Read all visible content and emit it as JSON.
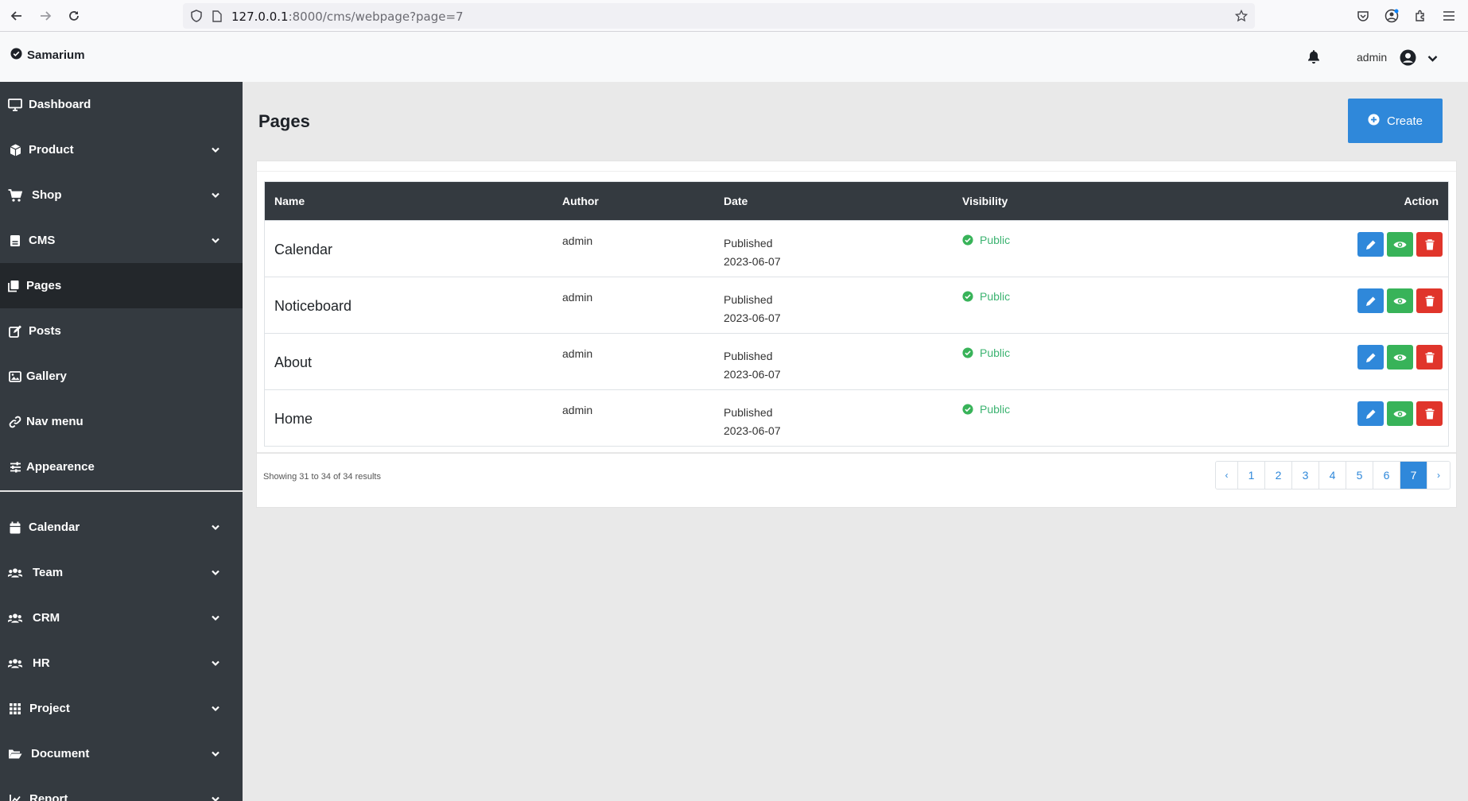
{
  "browser": {
    "url_host": "127.0.0.1",
    "url_rest": ":8000/cms/webpage?page=7"
  },
  "header": {
    "brand": "Samarium",
    "user": "admin"
  },
  "sidebar": {
    "items": [
      {
        "label": "Dashboard",
        "icon": "monitor-icon",
        "has_chevron": false,
        "active": false
      },
      {
        "label": "Product",
        "icon": "box-icon",
        "has_chevron": true,
        "active": false
      },
      {
        "label": "Shop",
        "icon": "cart-icon",
        "has_chevron": true,
        "active": false
      },
      {
        "label": "CMS",
        "icon": "cms-icon",
        "has_chevron": true,
        "active": false
      },
      {
        "label": "Pages",
        "icon": "pages-icon",
        "has_chevron": false,
        "active": true
      },
      {
        "label": "Posts",
        "icon": "edit-icon",
        "has_chevron": false,
        "active": false
      },
      {
        "label": "Gallery",
        "icon": "image-icon",
        "has_chevron": false,
        "active": false
      },
      {
        "label": "Nav menu",
        "icon": "link-icon",
        "has_chevron": false,
        "active": false
      },
      {
        "label": "Appearence",
        "icon": "sliders-icon",
        "has_chevron": false,
        "active": false
      },
      {
        "label": "Calendar",
        "icon": "calendar-icon",
        "has_chevron": true,
        "active": false
      },
      {
        "label": "Team",
        "icon": "users-icon",
        "has_chevron": true,
        "active": false
      },
      {
        "label": "CRM",
        "icon": "users-icon",
        "has_chevron": true,
        "active": false
      },
      {
        "label": "HR",
        "icon": "users-icon",
        "has_chevron": true,
        "active": false
      },
      {
        "label": "Project",
        "icon": "grid-icon",
        "has_chevron": true,
        "active": false
      },
      {
        "label": "Document",
        "icon": "folder-icon",
        "has_chevron": true,
        "active": false
      },
      {
        "label": "Report",
        "icon": "chart-icon",
        "has_chevron": true,
        "active": false
      }
    ]
  },
  "main": {
    "title": "Pages",
    "create_label": "Create",
    "table": {
      "headers": {
        "name": "Name",
        "author": "Author",
        "date": "Date",
        "visibility": "Visibility",
        "action": "Action"
      },
      "rows": [
        {
          "name": "Calendar",
          "author": "admin",
          "status": "Published",
          "date": "2023-06-07",
          "visibility": "Public"
        },
        {
          "name": "Noticeboard",
          "author": "admin",
          "status": "Published",
          "date": "2023-06-07",
          "visibility": "Public"
        },
        {
          "name": "About",
          "author": "admin",
          "status": "Published",
          "date": "2023-06-07",
          "visibility": "Public"
        },
        {
          "name": "Home",
          "author": "admin",
          "status": "Published",
          "date": "2023-06-07",
          "visibility": "Public"
        }
      ]
    },
    "results_text": "Showing 31 to 34 of 34 results",
    "pagination": {
      "prev": "‹",
      "next": "›",
      "pages": [
        "1",
        "2",
        "3",
        "4",
        "5",
        "6",
        "7"
      ],
      "current": "7"
    }
  },
  "colors": {
    "accent": "#2f88da",
    "success": "#38b359",
    "danger": "#e0352b",
    "sidebar": "#343a40"
  }
}
